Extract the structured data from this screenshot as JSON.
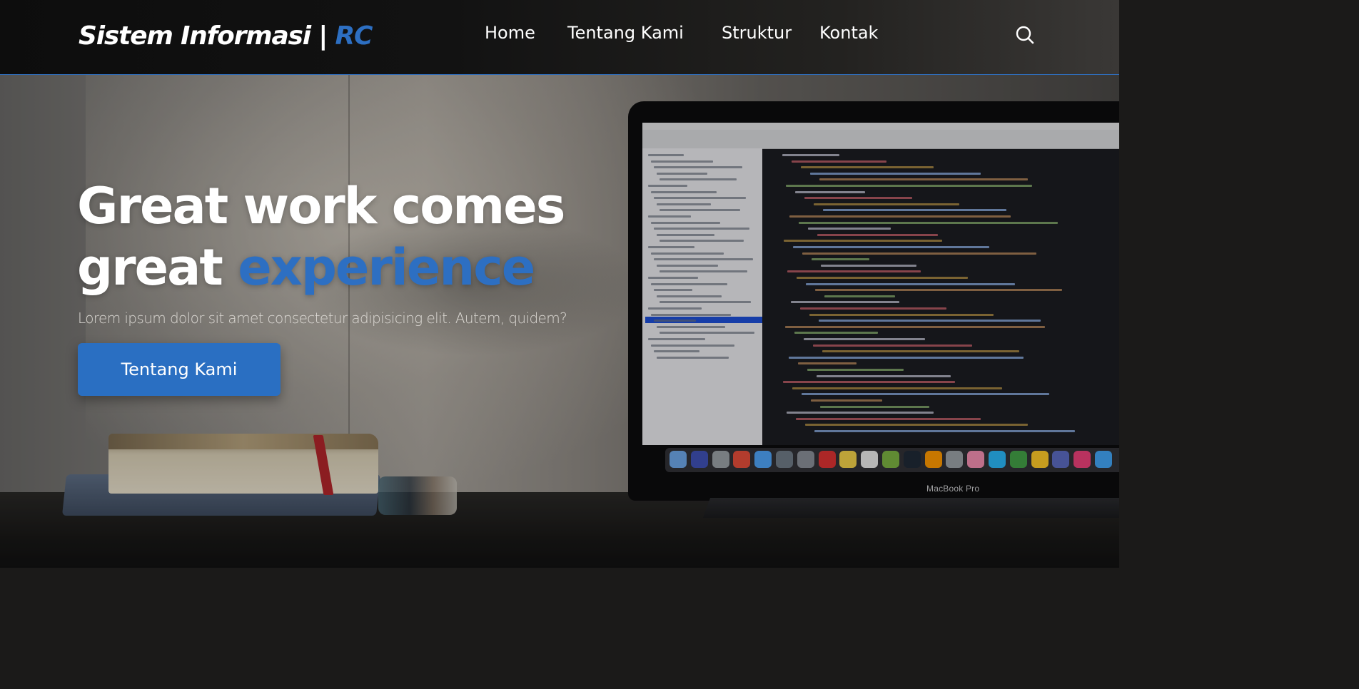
{
  "header": {
    "logo_main": "Sistem Informasi | ",
    "logo_accent": "RC",
    "nav": [
      {
        "label": "Home"
      },
      {
        "label": "Tentang Kami"
      },
      {
        "label": "Struktur"
      },
      {
        "label": "Kontak"
      }
    ],
    "search_icon": "search-icon"
  },
  "hero": {
    "title_line1": "Great work comes",
    "title_line2_plain": "great ",
    "title_line2_accent": "experience",
    "subtitle": "Lorem ipsum dolor sit amet consectetur adipisicing elit. Autem, quidem?",
    "cta_label": "Tentang Kami",
    "laptop_label": "MacBook Pro"
  },
  "colors": {
    "accent": "#2d6fc2",
    "button": "#2a6fc2",
    "header_bg": "#0d0d0d",
    "text": "#ffffff"
  }
}
